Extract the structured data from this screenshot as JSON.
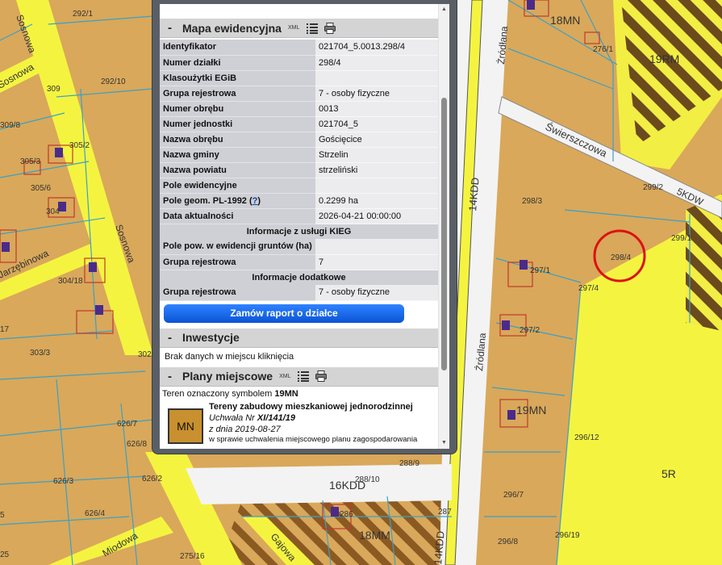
{
  "panel": {
    "section1": {
      "toggle": "-",
      "title": "Mapa ewidencyjna",
      "xml": "XML",
      "rows": [
        {
          "key": "Identyfikator",
          "value": "021704_5.0013.298/4"
        },
        {
          "key": "Numer działki",
          "value": "298/4"
        },
        {
          "key": "Klasoużytki EGiB",
          "value": ""
        },
        {
          "key": "Grupa rejestrowa",
          "value": "7 - osoby fizyczne"
        },
        {
          "key": "Numer obrębu",
          "value": "0013"
        },
        {
          "key": "Numer jednostki",
          "value": "021704_5"
        },
        {
          "key": "Nazwa obrębu",
          "value": "Gościęcice"
        },
        {
          "key": "Nazwa gminy",
          "value": "Strzelin"
        },
        {
          "key": "Nazwa powiatu",
          "value": "strzeliński"
        },
        {
          "key": "Pole ewidencyjne",
          "value": ""
        },
        {
          "key": "Pole geom. PL-1992",
          "help": "?",
          "value": "0.2299 ha"
        },
        {
          "key": "Data aktualności",
          "value": "2026-04-21 00:00:00"
        }
      ],
      "kieg_header": "Informacje z usługi KIEG",
      "kieg_rows": [
        {
          "key": "Pole pow. w ewidencji gruntów (ha)",
          "value": ""
        },
        {
          "key": "Grupa rejestrowa",
          "value": "7"
        }
      ],
      "extra_header": "Informacje dodatkowe",
      "extra_rows": [
        {
          "key": "Grupa rejestrowa",
          "value": "7 - osoby fizyczne"
        }
      ],
      "order_button": "Zamów raport o działce"
    },
    "section2": {
      "toggle": "-",
      "title": "Inwestycje",
      "message": "Brak danych w miejscu kliknięcia"
    },
    "section3": {
      "toggle": "-",
      "title": "Plany miejscowe",
      "xml": "XML",
      "intro": "Teren oznaczony symbolem",
      "symbol": "19MN",
      "box_label": "MN",
      "plan_title": "Tereny zabudowy mieszkaniowej jednorodzinnej",
      "uchwala_prefix": "Uchwała Nr ",
      "uchwala_number": "XI/141/19",
      "date_prefix": "z dnia ",
      "date": "2019-08-27",
      "desc": "w sprawie uchwalenia miejscowego planu zagospodarowania"
    }
  },
  "map": {
    "colors": {
      "parcel": "#d9a85a",
      "yellow": "#f4f440",
      "road": "#f0f0f0",
      "selection": "#dd1111"
    },
    "labels": [
      {
        "text": "Sosnowa"
      },
      {
        "text": "Sosnowa"
      },
      {
        "text": "Sosnowa"
      },
      {
        "text": "Jarzębinowa"
      },
      {
        "text": "Żródłana"
      },
      {
        "text": "Źródlana"
      },
      {
        "text": "Świerszczowa"
      },
      {
        "text": "Gajowa"
      },
      {
        "text": "Miodowa"
      },
      {
        "text": "18MN"
      },
      {
        "text": "19RM"
      },
      {
        "text": "19MN"
      },
      {
        "text": "18MM"
      },
      {
        "text": "5R"
      },
      {
        "text": "5KDW"
      },
      {
        "text": "14KDD"
      },
      {
        "text": "14KDD"
      },
      {
        "text": "16KDD"
      },
      {
        "text": "298/4"
      },
      {
        "text": "298/3"
      },
      {
        "text": "299/2"
      },
      {
        "text": "299/1"
      },
      {
        "text": "297/1"
      },
      {
        "text": "297/2"
      },
      {
        "text": "297/4"
      },
      {
        "text": "296/12"
      },
      {
        "text": "296/7"
      },
      {
        "text": "296/8"
      },
      {
        "text": "296/19"
      },
      {
        "text": "276/1"
      },
      {
        "text": "292/1"
      },
      {
        "text": "292/10"
      },
      {
        "text": "309"
      },
      {
        "text": "309/8"
      },
      {
        "text": "305/3"
      },
      {
        "text": "305/6"
      },
      {
        "text": "304"
      },
      {
        "text": "305/2"
      },
      {
        "text": "304/18"
      },
      {
        "text": "303/3"
      },
      {
        "text": "626/7"
      },
      {
        "text": "626/8"
      },
      {
        "text": "626/3"
      },
      {
        "text": "626/2"
      },
      {
        "text": "626/4"
      },
      {
        "text": "288/9"
      },
      {
        "text": "288/10"
      },
      {
        "text": "275/16"
      },
      {
        "text": "286"
      },
      {
        "text": "287"
      },
      {
        "text": "302"
      },
      {
        "text": "17"
      },
      {
        "text": "5"
      },
      {
        "text": "25"
      }
    ]
  }
}
